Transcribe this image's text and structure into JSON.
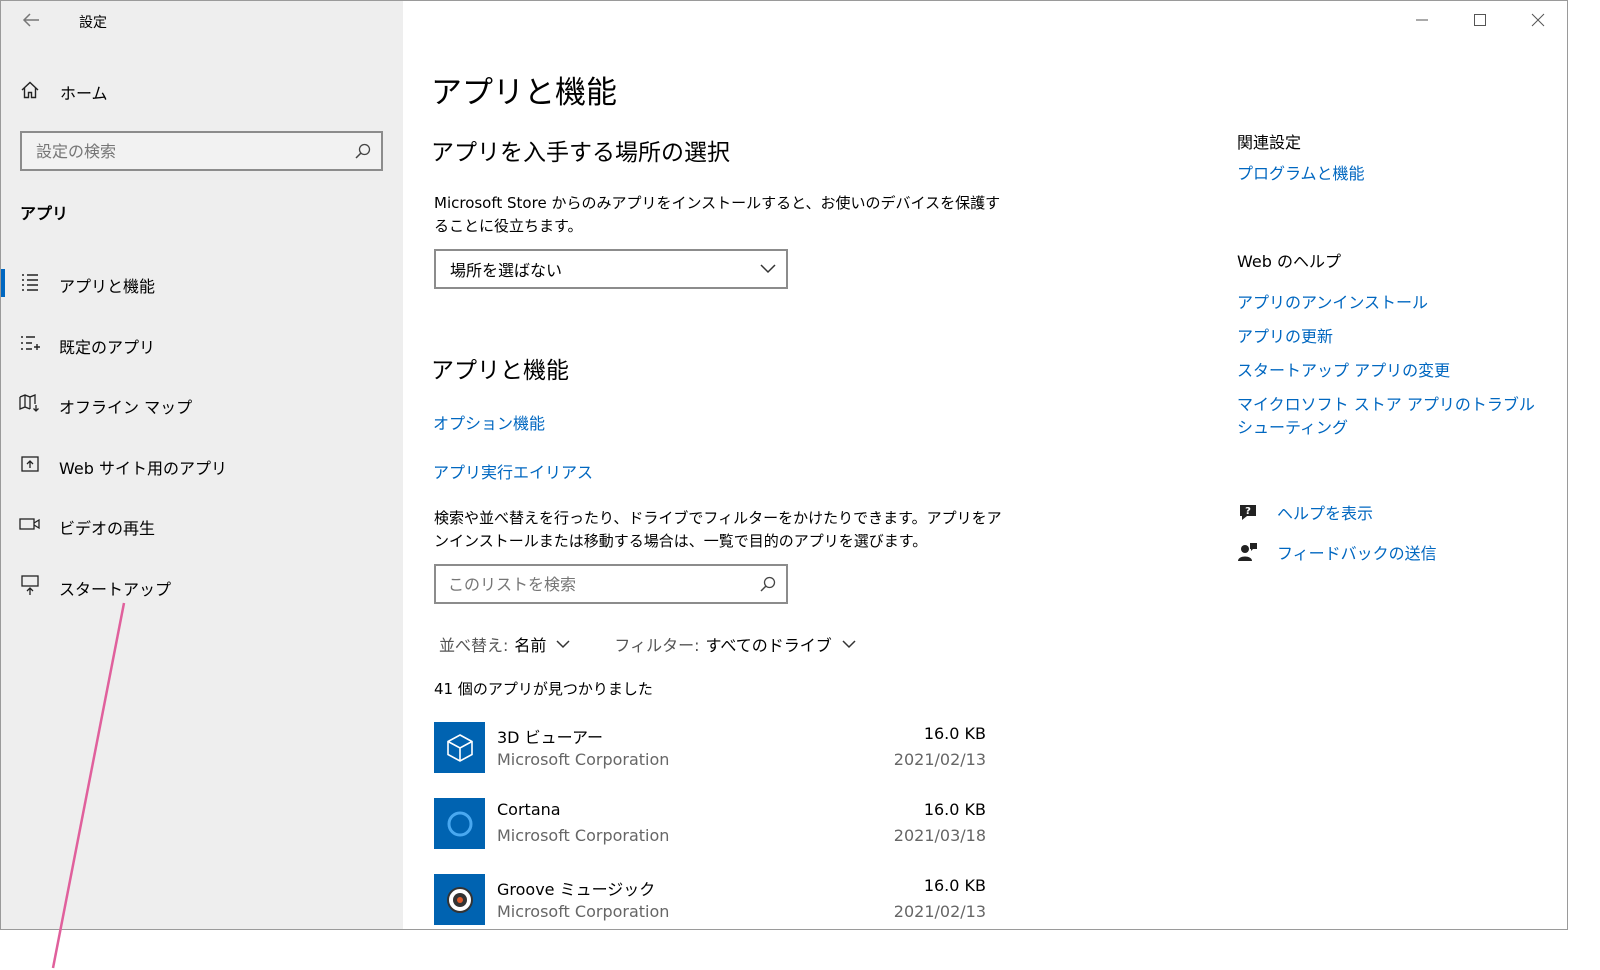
{
  "window": {
    "title": "設定"
  },
  "sidebar": {
    "home_label": "ホーム",
    "search_placeholder": "設定の検索",
    "section_label": "アプリ",
    "items": [
      {
        "label": "アプリと機能",
        "icon": "apps-features-icon",
        "selected": true
      },
      {
        "label": "既定のアプリ",
        "icon": "default-apps-icon",
        "selected": false
      },
      {
        "label": "オフライン マップ",
        "icon": "offline-maps-icon",
        "selected": false
      },
      {
        "label": "Web サイト用のアプリ",
        "icon": "apps-for-websites-icon",
        "selected": false
      },
      {
        "label": "ビデオの再生",
        "icon": "video-playback-icon",
        "selected": false
      },
      {
        "label": "スタートアップ",
        "icon": "startup-icon",
        "selected": false
      }
    ]
  },
  "main": {
    "page_title": "アプリと機能",
    "choose_section": {
      "heading": "アプリを入手する場所の選択",
      "description": "Microsoft Store からのみアプリをインストールすると、お使いのデバイスを保護することに役立ちます。",
      "dropdown_value": "場所を選ばない"
    },
    "apps_section": {
      "heading": "アプリと機能",
      "optional_features_link": "オプション機能",
      "app_aliases_link": "アプリ実行エイリアス",
      "description": "検索や並べ替えを行ったり、ドライブでフィルターをかけたりできます。アプリをアンインストールまたは移動する場合は、一覧で目的のアプリを選びます。",
      "list_search_placeholder": "このリストを検索",
      "sort_label": "並べ替え:",
      "sort_value": "名前",
      "filter_label": "フィルター:",
      "filter_value": "すべてのドライブ",
      "count_text": "41 個のアプリが見つかりました",
      "apps": [
        {
          "name": "3D ビューアー",
          "publisher": "Microsoft Corporation",
          "size": "16.0 KB",
          "date": "2021/02/13",
          "icon": "cube-icon"
        },
        {
          "name": "Cortana",
          "publisher": "Microsoft Corporation",
          "size": "16.0 KB",
          "date": "2021/03/18",
          "icon": "cortana-ring-icon"
        },
        {
          "name": "Groove ミュージック",
          "publisher": "Microsoft Corporation",
          "size": "16.0 KB",
          "date": "2021/02/13",
          "icon": "groove-music-icon"
        }
      ]
    }
  },
  "related": {
    "heading": "関連設定",
    "programs_link": "プログラムと機能",
    "web_help_heading": "Web のヘルプ",
    "web_help_links": [
      "アプリのアンインストール",
      "アプリの更新",
      "スタートアップ アプリの変更",
      "マイクロソフト ストア アプリのトラブルシューティング"
    ],
    "get_help_label": "ヘルプを表示",
    "feedback_label": "フィードバックの送信"
  },
  "colors": {
    "accent": "#0067c0",
    "sidebar_bg": "#eeeeee",
    "tile_bg": "#0063b1",
    "annotation": "#e0609c"
  }
}
